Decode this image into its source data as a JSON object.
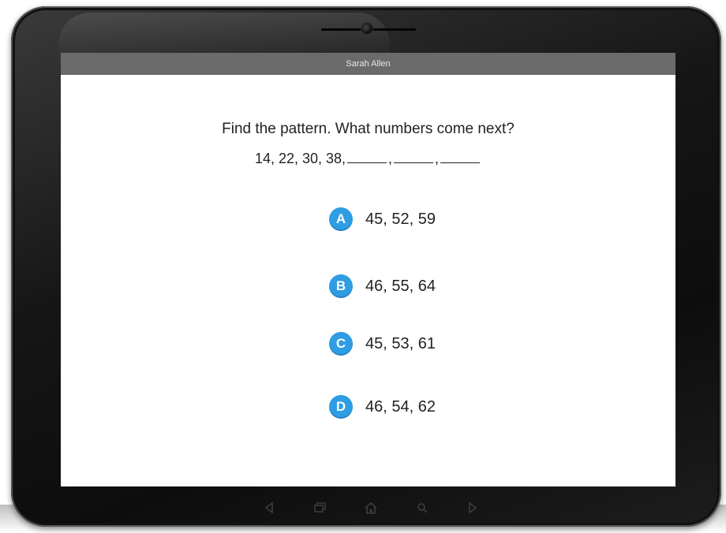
{
  "header": {
    "user_name": "Sarah Allen"
  },
  "question": {
    "prompt": "Find the pattern. What numbers come next?",
    "sequence": "14, 22, 30, 38,",
    "sep1": ",",
    "sep2": ","
  },
  "choices": [
    {
      "letter": "A",
      "answer": "45, 52, 59"
    },
    {
      "letter": "B",
      "answer": "46, 55, 64"
    },
    {
      "letter": "C",
      "answer": "45, 53, 61"
    },
    {
      "letter": "D",
      "answer": "46, 54, 62"
    }
  ],
  "nav_bar": {
    "icons": [
      "back-icon",
      "recent-apps-icon",
      "home-icon",
      "search-icon",
      "forward-icon"
    ]
  },
  "colors": {
    "accent": "#2e9de4",
    "header_bg": "#6b6b6b",
    "bezel": "#111111"
  }
}
